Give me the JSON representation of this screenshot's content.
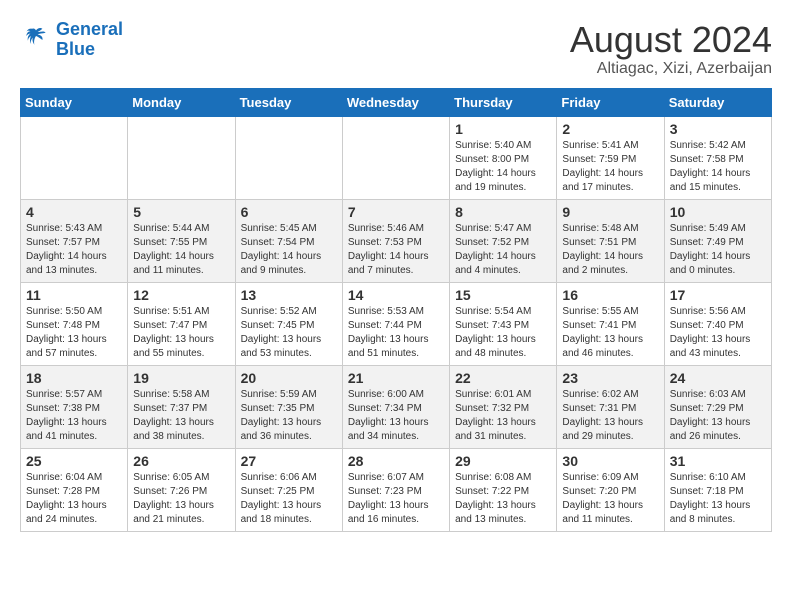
{
  "header": {
    "logo_line1": "General",
    "logo_line2": "Blue",
    "month": "August 2024",
    "location": "Altiagac, Xizi, Azerbaijan"
  },
  "weekdays": [
    "Sunday",
    "Monday",
    "Tuesday",
    "Wednesday",
    "Thursday",
    "Friday",
    "Saturday"
  ],
  "weeks": [
    [
      {
        "day": "",
        "detail": ""
      },
      {
        "day": "",
        "detail": ""
      },
      {
        "day": "",
        "detail": ""
      },
      {
        "day": "",
        "detail": ""
      },
      {
        "day": "1",
        "detail": "Sunrise: 5:40 AM\nSunset: 8:00 PM\nDaylight: 14 hours\nand 19 minutes."
      },
      {
        "day": "2",
        "detail": "Sunrise: 5:41 AM\nSunset: 7:59 PM\nDaylight: 14 hours\nand 17 minutes."
      },
      {
        "day": "3",
        "detail": "Sunrise: 5:42 AM\nSunset: 7:58 PM\nDaylight: 14 hours\nand 15 minutes."
      }
    ],
    [
      {
        "day": "4",
        "detail": "Sunrise: 5:43 AM\nSunset: 7:57 PM\nDaylight: 14 hours\nand 13 minutes."
      },
      {
        "day": "5",
        "detail": "Sunrise: 5:44 AM\nSunset: 7:55 PM\nDaylight: 14 hours\nand 11 minutes."
      },
      {
        "day": "6",
        "detail": "Sunrise: 5:45 AM\nSunset: 7:54 PM\nDaylight: 14 hours\nand 9 minutes."
      },
      {
        "day": "7",
        "detail": "Sunrise: 5:46 AM\nSunset: 7:53 PM\nDaylight: 14 hours\nand 7 minutes."
      },
      {
        "day": "8",
        "detail": "Sunrise: 5:47 AM\nSunset: 7:52 PM\nDaylight: 14 hours\nand 4 minutes."
      },
      {
        "day": "9",
        "detail": "Sunrise: 5:48 AM\nSunset: 7:51 PM\nDaylight: 14 hours\nand 2 minutes."
      },
      {
        "day": "10",
        "detail": "Sunrise: 5:49 AM\nSunset: 7:49 PM\nDaylight: 14 hours\nand 0 minutes."
      }
    ],
    [
      {
        "day": "11",
        "detail": "Sunrise: 5:50 AM\nSunset: 7:48 PM\nDaylight: 13 hours\nand 57 minutes."
      },
      {
        "day": "12",
        "detail": "Sunrise: 5:51 AM\nSunset: 7:47 PM\nDaylight: 13 hours\nand 55 minutes."
      },
      {
        "day": "13",
        "detail": "Sunrise: 5:52 AM\nSunset: 7:45 PM\nDaylight: 13 hours\nand 53 minutes."
      },
      {
        "day": "14",
        "detail": "Sunrise: 5:53 AM\nSunset: 7:44 PM\nDaylight: 13 hours\nand 51 minutes."
      },
      {
        "day": "15",
        "detail": "Sunrise: 5:54 AM\nSunset: 7:43 PM\nDaylight: 13 hours\nand 48 minutes."
      },
      {
        "day": "16",
        "detail": "Sunrise: 5:55 AM\nSunset: 7:41 PM\nDaylight: 13 hours\nand 46 minutes."
      },
      {
        "day": "17",
        "detail": "Sunrise: 5:56 AM\nSunset: 7:40 PM\nDaylight: 13 hours\nand 43 minutes."
      }
    ],
    [
      {
        "day": "18",
        "detail": "Sunrise: 5:57 AM\nSunset: 7:38 PM\nDaylight: 13 hours\nand 41 minutes."
      },
      {
        "day": "19",
        "detail": "Sunrise: 5:58 AM\nSunset: 7:37 PM\nDaylight: 13 hours\nand 38 minutes."
      },
      {
        "day": "20",
        "detail": "Sunrise: 5:59 AM\nSunset: 7:35 PM\nDaylight: 13 hours\nand 36 minutes."
      },
      {
        "day": "21",
        "detail": "Sunrise: 6:00 AM\nSunset: 7:34 PM\nDaylight: 13 hours\nand 34 minutes."
      },
      {
        "day": "22",
        "detail": "Sunrise: 6:01 AM\nSunset: 7:32 PM\nDaylight: 13 hours\nand 31 minutes."
      },
      {
        "day": "23",
        "detail": "Sunrise: 6:02 AM\nSunset: 7:31 PM\nDaylight: 13 hours\nand 29 minutes."
      },
      {
        "day": "24",
        "detail": "Sunrise: 6:03 AM\nSunset: 7:29 PM\nDaylight: 13 hours\nand 26 minutes."
      }
    ],
    [
      {
        "day": "25",
        "detail": "Sunrise: 6:04 AM\nSunset: 7:28 PM\nDaylight: 13 hours\nand 24 minutes."
      },
      {
        "day": "26",
        "detail": "Sunrise: 6:05 AM\nSunset: 7:26 PM\nDaylight: 13 hours\nand 21 minutes."
      },
      {
        "day": "27",
        "detail": "Sunrise: 6:06 AM\nSunset: 7:25 PM\nDaylight: 13 hours\nand 18 minutes."
      },
      {
        "day": "28",
        "detail": "Sunrise: 6:07 AM\nSunset: 7:23 PM\nDaylight: 13 hours\nand 16 minutes."
      },
      {
        "day": "29",
        "detail": "Sunrise: 6:08 AM\nSunset: 7:22 PM\nDaylight: 13 hours\nand 13 minutes."
      },
      {
        "day": "30",
        "detail": "Sunrise: 6:09 AM\nSunset: 7:20 PM\nDaylight: 13 hours\nand 11 minutes."
      },
      {
        "day": "31",
        "detail": "Sunrise: 6:10 AM\nSunset: 7:18 PM\nDaylight: 13 hours\nand 8 minutes."
      }
    ]
  ]
}
